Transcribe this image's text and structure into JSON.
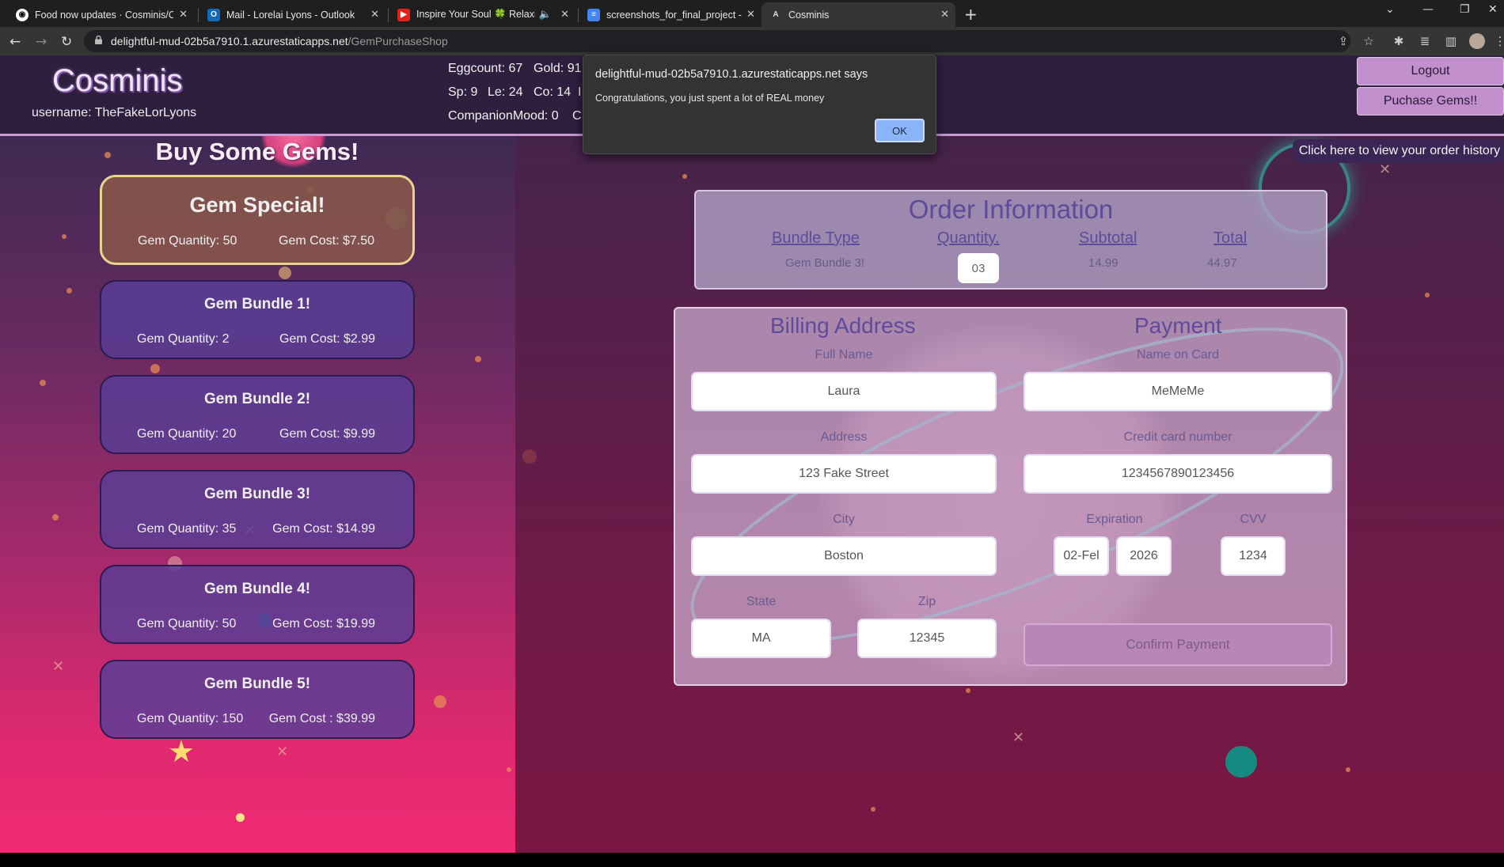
{
  "browser": {
    "tabs": [
      {
        "label": "Food now updates · Cosminis/Co",
        "icon": "github-icon"
      },
      {
        "label": "Mail - Lorelai Lyons - Outlook",
        "icon": "outlook-icon"
      },
      {
        "label": "Inspire Your Soul 🍀 Relaxin",
        "icon": "youtube-icon"
      },
      {
        "label": "screenshots_for_final_project - G",
        "icon": "docs-icon"
      },
      {
        "label": "Cosminis",
        "icon": "app-icon"
      }
    ],
    "url_host": "delightful-mud-02b5a7910.1.azurestaticapps.net",
    "url_path": "/GemPurchaseShop"
  },
  "header": {
    "logo": "Cosminis",
    "username": "username: TheFakeLorLyons",
    "stats": {
      "eggcount": "Eggcount: 67",
      "gold": "Gold: 91",
      "sp": "Sp: 9",
      "le": "Le: 24",
      "co": "Co: 14",
      "stat_cut": "I",
      "mood": "CompanionMood: 0",
      "mood_cut": "C"
    },
    "logout": "Logout",
    "purchase_gems": "Puchase Gems!!",
    "history": "Click here to view your order history"
  },
  "shop": {
    "title": "Buy Some Gems!",
    "special": {
      "name": "Gem Special!",
      "quantity": "Gem Quantity: 50",
      "cost": "Gem Cost: $7.50"
    },
    "bundles": [
      {
        "name": "Gem Bundle 1!",
        "quantity": "Gem Quantity: 2",
        "cost": "Gem Cost: $2.99"
      },
      {
        "name": "Gem Bundle 2!",
        "quantity": "Gem Quantity: 20",
        "cost": "Gem Cost: $9.99"
      },
      {
        "name": "Gem Bundle 3!",
        "quantity": "Gem Quantity: 35",
        "cost": "Gem Cost: $14.99"
      },
      {
        "name": "Gem Bundle 4!",
        "quantity": "Gem Quantity: 50",
        "cost": "Gem Cost: $19.99"
      },
      {
        "name": "Gem Bundle 5!",
        "quantity": "Gem Quantity: 150",
        "cost": "Gem Cost : $39.99"
      }
    ]
  },
  "order": {
    "title": "Order Information",
    "headers": {
      "bundle": "Bundle Type",
      "quantity": "Quantity.",
      "subtotal": "Subtotal",
      "total": "Total"
    },
    "bundle_value": "Gem Bundle 3!",
    "quantity_value": "03",
    "subtotal_value": "14.99",
    "total_value": "44.97"
  },
  "billing": {
    "title": "Billing Address",
    "full_name_label": "Full Name",
    "full_name": "Laura",
    "address_label": "Address",
    "address": "123 Fake Street",
    "city_label": "City",
    "city": "Boston",
    "state_label": "State",
    "state": "MA",
    "zip_label": "Zip",
    "zip": "12345"
  },
  "payment": {
    "title": "Payment",
    "name_label": "Name on Card",
    "name": "MeMeMe",
    "card_label": "Credit card number",
    "card": "1234567890123456",
    "exp_label": "Expiration",
    "exp_month": "02-Fel",
    "exp_year": "2026",
    "cvv_label": "CVV",
    "cvv": "1234",
    "confirm": "Confirm Payment"
  },
  "dialog": {
    "title": "delightful-mud-02b5a7910.1.azurestaticapps.net says",
    "message": "Congratulations, you just spent a lot of REAL money",
    "ok": "OK"
  }
}
